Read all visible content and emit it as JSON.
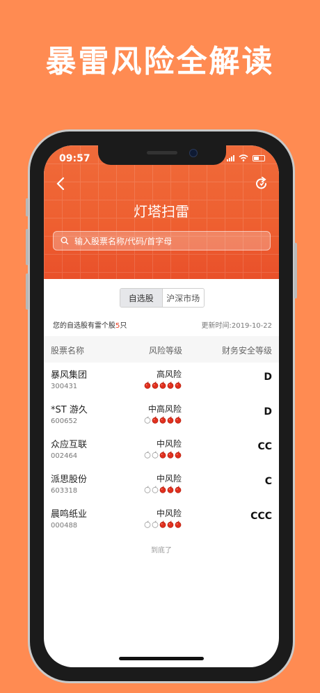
{
  "promo": {
    "headline": "暴雷风险全解读"
  },
  "status_bar": {
    "time": "09:57"
  },
  "nav": {
    "title": "灯塔扫雷"
  },
  "search": {
    "placeholder": "输入股票名称/代码/首字母"
  },
  "segments": [
    "自选股",
    "沪深市场"
  ],
  "info": {
    "prefix": "您的自选股有雷个股",
    "count": "5",
    "suffix": "只",
    "updated": "更新时间:2019-10-22"
  },
  "columns": [
    "股票名称",
    "风险等级",
    "财务安全等级"
  ],
  "stocks": [
    {
      "name": "暴风集团",
      "code": "300431",
      "risk": "高风险",
      "mines": 5,
      "grade": "D"
    },
    {
      "name": "*ST 游久",
      "code": "600652",
      "risk": "中高风险",
      "mines": 4,
      "grade": "D"
    },
    {
      "name": "众应互联",
      "code": "002464",
      "risk": "中风险",
      "mines": 3,
      "grade": "CC"
    },
    {
      "name": "派思股份",
      "code": "603318",
      "risk": "中风险",
      "mines": 3,
      "grade": "C"
    },
    {
      "name": "晨鸣纸业",
      "code": "000488",
      "risk": "中风险",
      "mines": 3,
      "grade": "CCC"
    }
  ],
  "mines_total": 5,
  "footer": {
    "end_text": "到底了"
  },
  "colors": {
    "accent": "#EE5F30",
    "background": "#FF8B52",
    "mine_red": "#E0301E"
  },
  "icons": [
    "back-arrow-icon",
    "refresh-icon",
    "search-icon",
    "signal-icon",
    "wifi-icon",
    "battery-icon",
    "mine-icon"
  ]
}
